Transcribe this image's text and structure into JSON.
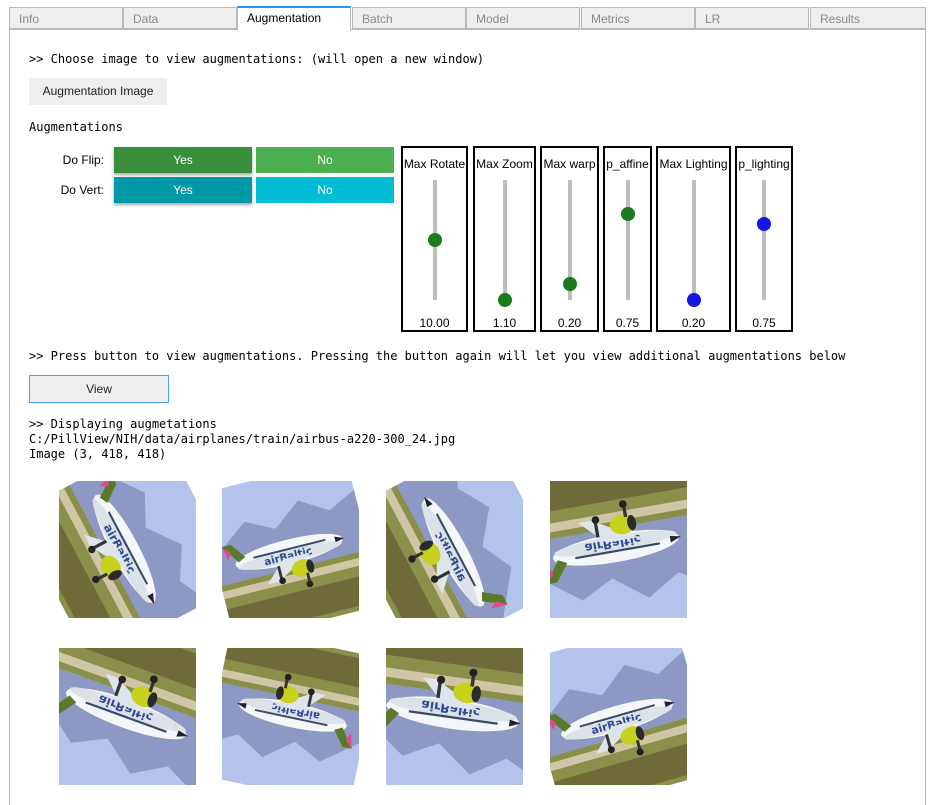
{
  "tabs": [
    {
      "label": "Info",
      "active": false
    },
    {
      "label": "Data",
      "active": false
    },
    {
      "label": "Augmentation",
      "active": true
    },
    {
      "label": "Batch",
      "active": false
    },
    {
      "label": "Model",
      "active": false
    },
    {
      "label": "Metrics",
      "active": false
    },
    {
      "label": "LR",
      "active": false
    },
    {
      "label": "Results",
      "active": false
    }
  ],
  "choose_prompt": ">> Choose image to view augmentations: (will open a new window)",
  "augmentation_image_button": "Augmentation Image",
  "augmentations_heading": "Augmentations",
  "toggles": {
    "flip": {
      "label": "Do Flip:",
      "yes": "Yes",
      "no": "No",
      "selected": "Yes"
    },
    "vert": {
      "label": "Do Vert:",
      "yes": "Yes",
      "no": "No",
      "selected": "Yes"
    }
  },
  "sliders": [
    {
      "title": "Max Rotate",
      "value": "10.00",
      "level": 0.5,
      "color": "#1b7a1b"
    },
    {
      "title": "Max Zoom",
      "value": "1.10",
      "level": 0.0,
      "color": "#1b7a1b"
    },
    {
      "title": "Max warp",
      "value": "0.20",
      "level": 0.13,
      "color": "#1b7a1b"
    },
    {
      "title": "p_affine",
      "value": "0.75",
      "level": 0.72,
      "color": "#1b7a1b"
    },
    {
      "title": "Max Lighting",
      "value": "0.20",
      "level": 0.0,
      "color": "#1515e0"
    },
    {
      "title": "p_lighting",
      "value": "0.75",
      "level": 0.63,
      "color": "#1515e0"
    }
  ],
  "press_prompt": ">> Press button to view augmentations.  Pressing the button again will let you view additional augmentations below",
  "view_button": "View",
  "display": {
    "heading": ">> Displaying augmetations",
    "path": "C:/PillView/NIH/data/airplanes/train/airbus-a220-300_24.jpg",
    "shape": "Image (3, 418, 418)"
  },
  "augmented_images": [
    {
      "variant": "rot-a"
    },
    {
      "variant": "bank-left"
    },
    {
      "variant": "rot-b"
    },
    {
      "variant": "flip-up"
    },
    {
      "variant": "flip-down"
    },
    {
      "variant": "bank-right"
    },
    {
      "variant": "flip-down-2"
    },
    {
      "variant": "bank-left-2"
    }
  ]
}
